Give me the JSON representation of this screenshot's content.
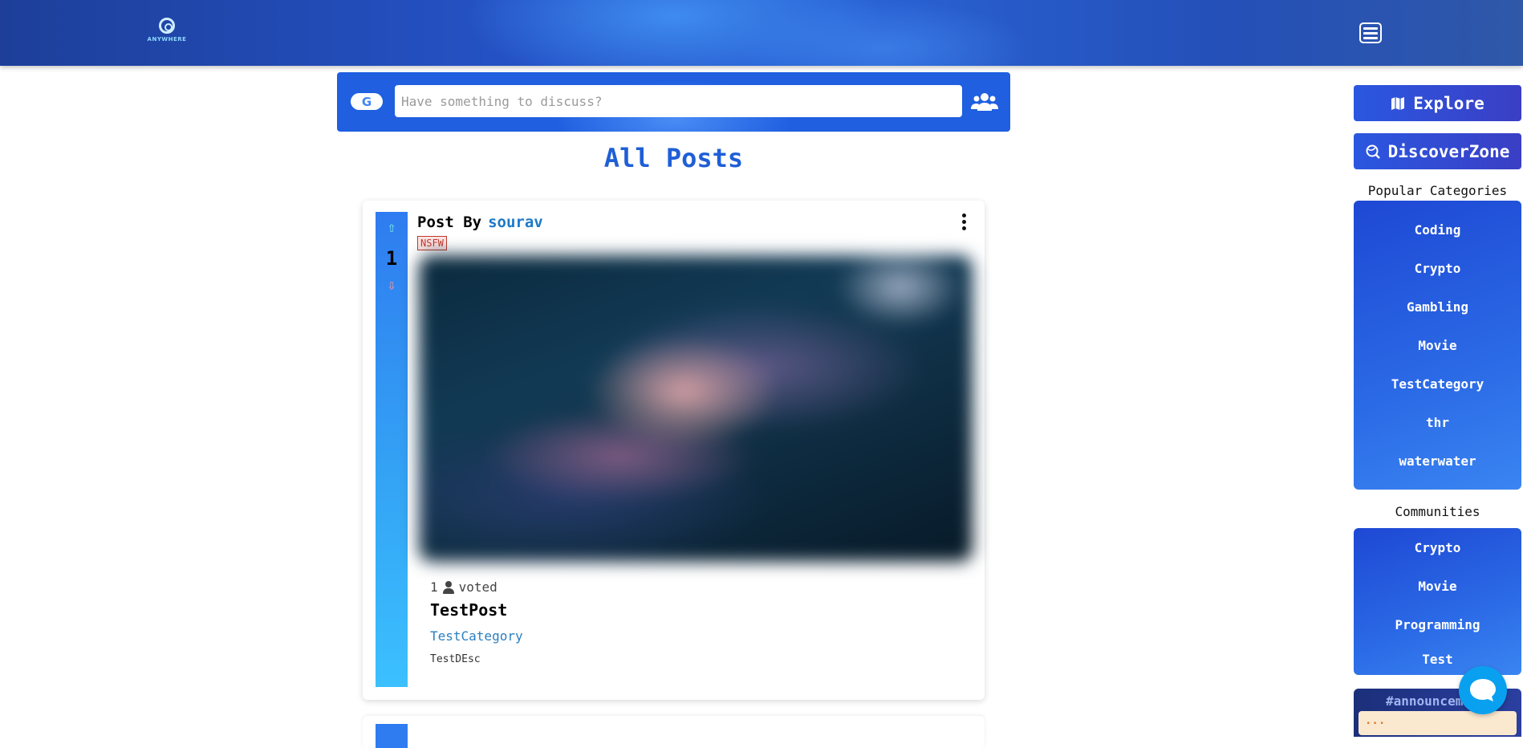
{
  "header": {
    "logo_text": "ANYWHERE",
    "logo_icon": "eye-logo",
    "menu_icon": "panel-menu-icon"
  },
  "search": {
    "placeholder": "Have something to discuss?",
    "value": "",
    "google_icon": "google-icon",
    "google_letter": "G",
    "community_icon": "users-icon"
  },
  "main": {
    "title": "All Posts"
  },
  "posts": [
    {
      "post_by_label": "Post By",
      "author": "sourav",
      "badge": "NSFW",
      "votes": "1",
      "voters_count": "1",
      "voted_label": "voted",
      "title": "TestPost",
      "category": "TestCategory",
      "description": "TestDEsc",
      "image_blurred": true
    }
  ],
  "sidebar": {
    "explore_label": "Explore",
    "discover_label": "DiscoverZone",
    "popular_heading": "Popular Categories",
    "categories": [
      "Coding",
      "Crypto",
      "Gambling",
      "Movie",
      "TestCategory",
      "thr",
      "waterwater"
    ],
    "communities_heading": "Communities",
    "communities": [
      "Crypto",
      "Movie",
      "Programming",
      "Test"
    ],
    "announcement_title": "#announcem",
    "announcement_preview": "..."
  },
  "colors": {
    "brand_blue": "#1f5fd6",
    "header_blue": "#2553c7",
    "author_link": "#1c79c8",
    "nsfw_red": "#c0392b",
    "chat_button": "#0aa0f0"
  }
}
